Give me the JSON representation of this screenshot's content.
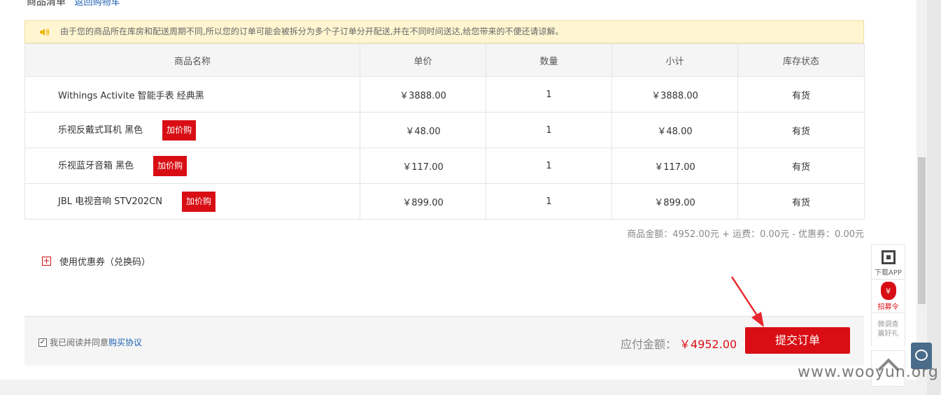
{
  "section": {
    "title": "商品清单",
    "back_link": "返回购物车"
  },
  "notice": {
    "text": "由于您的商品所在库房和配送周期不同,所以您的订单可能会被拆分为多个子订单分开配送,并在不同时间送达,给您带来的不便还请谅解。",
    "icon": "speaker-icon"
  },
  "table": {
    "headers": [
      "商品名称",
      "单价",
      "数量",
      "小计",
      "库存状态"
    ],
    "rows": [
      {
        "name": "Withings Activite 智能手表 经典黑",
        "tag": "",
        "price": "￥3888.00",
        "qty": "1",
        "subtotal": "￥3888.00",
        "stock": "有货"
      },
      {
        "name": "乐视反戴式耳机 黑色",
        "tag": "加价购",
        "price": "￥48.00",
        "qty": "1",
        "subtotal": "￥48.00",
        "stock": "有货"
      },
      {
        "name": "乐视蓝牙音箱 黑色",
        "tag": "加价购",
        "price": "￥117.00",
        "qty": "1",
        "subtotal": "￥117.00",
        "stock": "有货"
      },
      {
        "name": "JBL 电视音响 STV202CN",
        "tag": "加价购",
        "price": "￥899.00",
        "qty": "1",
        "subtotal": "￥899.00",
        "stock": "有货"
      }
    ]
  },
  "summary": "商品金额：4952.00元 + 运费：0.00元 - 优惠券：0.00元",
  "coupon": {
    "label": "使用优惠券（兑换码）"
  },
  "footer": {
    "agree_prefix": "我已阅读并同意",
    "agree_link": "购买协议",
    "pay_label": "应付金额：",
    "pay_amount": "￥4952.00",
    "submit_label": "提交订单"
  },
  "side_tools": {
    "qr_label": "下载APP",
    "recruit_symbol": "¥",
    "recruit_label": "招募令",
    "survey_line1": "微调查",
    "survey_line2": "赢好礼"
  },
  "watermark": "www.wooyun.org",
  "colors": {
    "accent": "#d80e14",
    "link": "#1a5fb4",
    "notice_bg": "#fff5d1"
  }
}
